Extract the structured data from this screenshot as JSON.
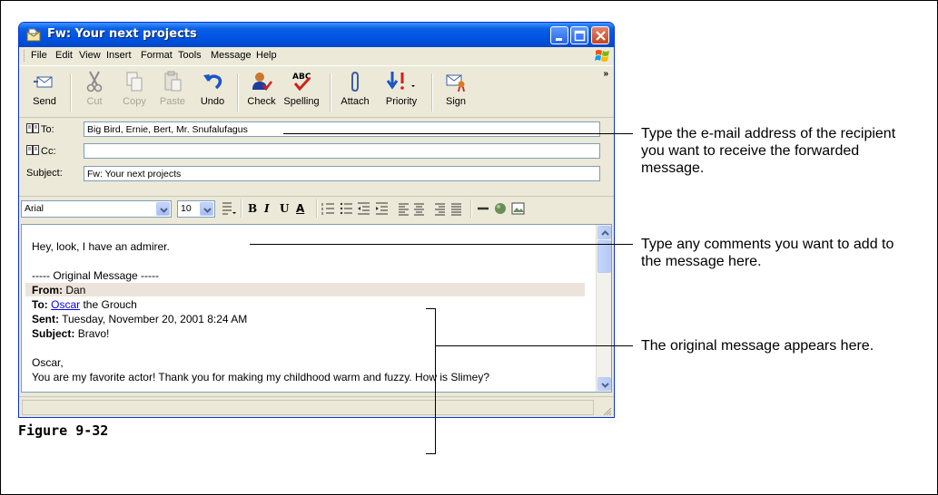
{
  "window": {
    "title": "Fw: Your next projects",
    "buttons": [
      "minimize",
      "maximize",
      "close"
    ]
  },
  "menubar": {
    "items": [
      "File",
      "Edit",
      "View",
      "Insert",
      "Format",
      "Tools",
      "Message",
      "Help"
    ]
  },
  "toolbar": {
    "buttons": [
      {
        "label": "Send",
        "icon": "send-icon",
        "enabled": true
      },
      {
        "label": "Cut",
        "icon": "scissors-icon",
        "enabled": false
      },
      {
        "label": "Copy",
        "icon": "copy-icon",
        "enabled": false
      },
      {
        "label": "Paste",
        "icon": "paste-icon",
        "enabled": false
      },
      {
        "label": "Undo",
        "icon": "undo-icon",
        "enabled": true
      },
      {
        "label": "Check",
        "icon": "check-names-icon",
        "enabled": true
      },
      {
        "label": "Spelling",
        "icon": "spelling-icon",
        "enabled": true
      },
      {
        "label": "Attach",
        "icon": "paperclip-icon",
        "enabled": true
      },
      {
        "label": "Priority",
        "icon": "priority-icon",
        "enabled": true
      },
      {
        "label": "Sign",
        "icon": "sign-icon",
        "enabled": true
      }
    ],
    "more": "»"
  },
  "header": {
    "to_label": "To:",
    "to_value": "Big Bird, Ernie, Bert, Mr. Snufalufagus",
    "cc_label": "Cc:",
    "cc_value": "",
    "subject_label": "Subject:",
    "subject_value": "Fw: Your next projects"
  },
  "format_bar": {
    "font": "Arial",
    "size": "10",
    "buttons": [
      "B",
      "I",
      "U",
      "A"
    ]
  },
  "message": {
    "comment": "Hey, look, I have an admirer.",
    "original_marker": "----- Original Message -----",
    "from_label": "From:",
    "from_value": "Dan",
    "to_label": "To:",
    "to_link": "Oscar",
    "to_rest": "the Grouch",
    "sent_label": "Sent:",
    "sent_value": "Tuesday, November 20, 2001 8:24 AM",
    "subject_label": "Subject:",
    "subject_value": "Bravo!",
    "greeting": "Oscar,",
    "body_line": "You are my favorite actor! Thank you for making my childhood warm and fuzzy. How is Slimey?"
  },
  "callouts": {
    "address": "Type the e-mail address of the recipient you want to receive the forwarded message.",
    "comments": "Type any comments you want to add to the message here.",
    "original": "The original message appears here."
  },
  "caption": "Figure 9-32",
  "colors": {
    "titlebar": "#0054e3",
    "window_face": "#ece9d8",
    "link": "#0000ff",
    "highlight_row": "#ece4da"
  }
}
